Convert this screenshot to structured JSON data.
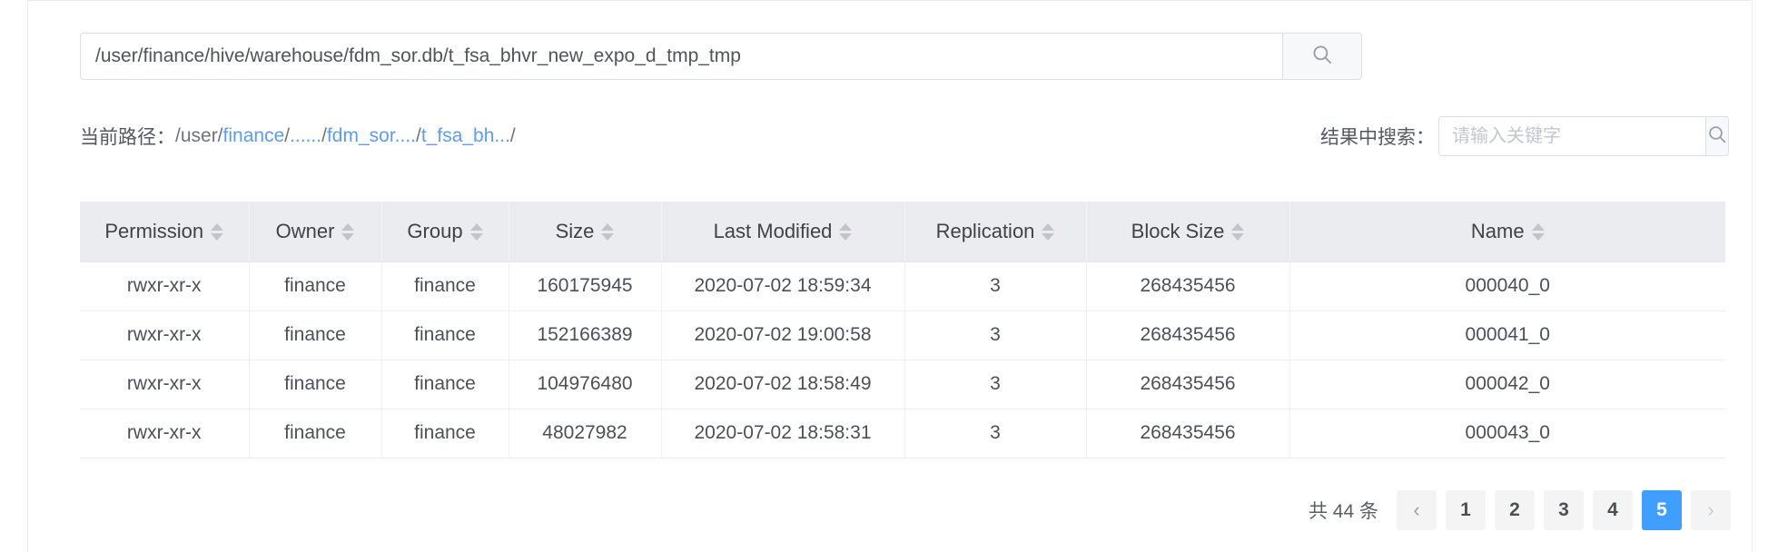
{
  "path_search": {
    "value": "/user/finance/hive/warehouse/fdm_sor.db/t_fsa_bhvr_new_expo_d_tmp_tmp",
    "placeholder": "",
    "button_icon": "search-icon"
  },
  "breadcrumb": {
    "label": "当前路径：",
    "root": "/user/",
    "segments": [
      {
        "text": "finance",
        "sep": "/"
      },
      {
        "text": "......",
        "sep": "/"
      },
      {
        "text": "fdm_sor....",
        "sep": "/"
      },
      {
        "text": "t_fsa_bh...",
        "sep": "/"
      }
    ]
  },
  "result_search": {
    "label": "结果中搜索：",
    "placeholder": "请输入关键字",
    "value": "",
    "button_icon": "search-icon"
  },
  "table": {
    "columns": [
      {
        "key": "permission",
        "label": "Permission",
        "sortable": true
      },
      {
        "key": "owner",
        "label": "Owner",
        "sortable": true
      },
      {
        "key": "group",
        "label": "Group",
        "sortable": true
      },
      {
        "key": "size",
        "label": "Size",
        "sortable": true
      },
      {
        "key": "last_modified",
        "label": "Last Modified",
        "sortable": true
      },
      {
        "key": "replication",
        "label": "Replication",
        "sortable": true
      },
      {
        "key": "block_size",
        "label": "Block Size",
        "sortable": true
      },
      {
        "key": "name",
        "label": "Name",
        "sortable": true
      }
    ],
    "rows": [
      {
        "permission": "rwxr-xr-x",
        "owner": "finance",
        "group": "finance",
        "size": "160175945",
        "last_modified": "2020-07-02 18:59:34",
        "replication": "3",
        "block_size": "268435456",
        "name": "000040_0"
      },
      {
        "permission": "rwxr-xr-x",
        "owner": "finance",
        "group": "finance",
        "size": "152166389",
        "last_modified": "2020-07-02 19:00:58",
        "replication": "3",
        "block_size": "268435456",
        "name": "000041_0"
      },
      {
        "permission": "rwxr-xr-x",
        "owner": "finance",
        "group": "finance",
        "size": "104976480",
        "last_modified": "2020-07-02 18:58:49",
        "replication": "3",
        "block_size": "268435456",
        "name": "000042_0"
      },
      {
        "permission": "rwxr-xr-x",
        "owner": "finance",
        "group": "finance",
        "size": "48027982",
        "last_modified": "2020-07-02 18:58:31",
        "replication": "3",
        "block_size": "268435456",
        "name": "000043_0"
      }
    ]
  },
  "pagination": {
    "total_text": "共 44 条",
    "prev_icon": "chevron-left-icon",
    "next_icon": "chevron-right-icon",
    "pages": [
      "1",
      "2",
      "3",
      "4",
      "5"
    ],
    "active_page": "5",
    "active_color": "#409EFF"
  }
}
